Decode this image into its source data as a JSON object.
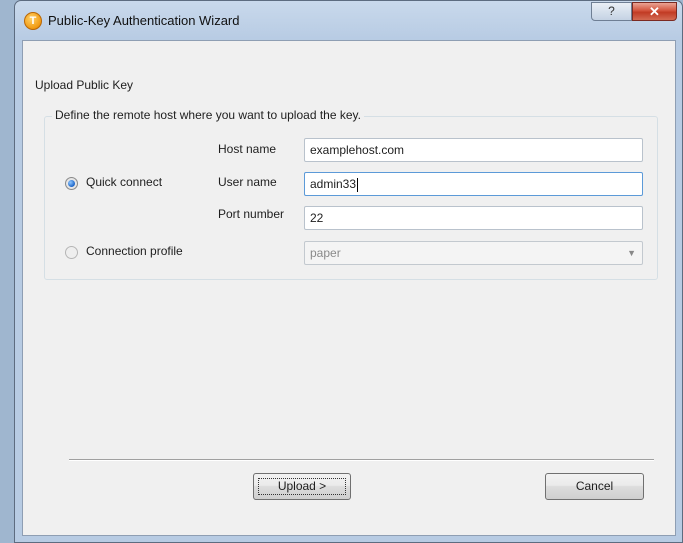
{
  "window": {
    "title": "Public-Key Authentication Wizard",
    "help_button": "?",
    "close_button": "✕",
    "app_icon_letter": "T"
  },
  "page": {
    "title": "Upload Public Key"
  },
  "group": {
    "legend": "Define the remote host where you want to upload the key."
  },
  "quick_connect": {
    "label": "Quick connect",
    "selected": true,
    "host_label": "Host name",
    "host_value": "examplehost.com",
    "user_label": "User name",
    "user_value": "admin33",
    "port_label": "Port number",
    "port_value": "22"
  },
  "connection_profile": {
    "label": "Connection profile",
    "selected": false,
    "value": "paper"
  },
  "buttons": {
    "upload": "Upload >",
    "cancel": "Cancel"
  },
  "colors": {
    "accent": "#1b64c8",
    "close": "#c13b24",
    "focus_border": "#5c9ad8"
  }
}
